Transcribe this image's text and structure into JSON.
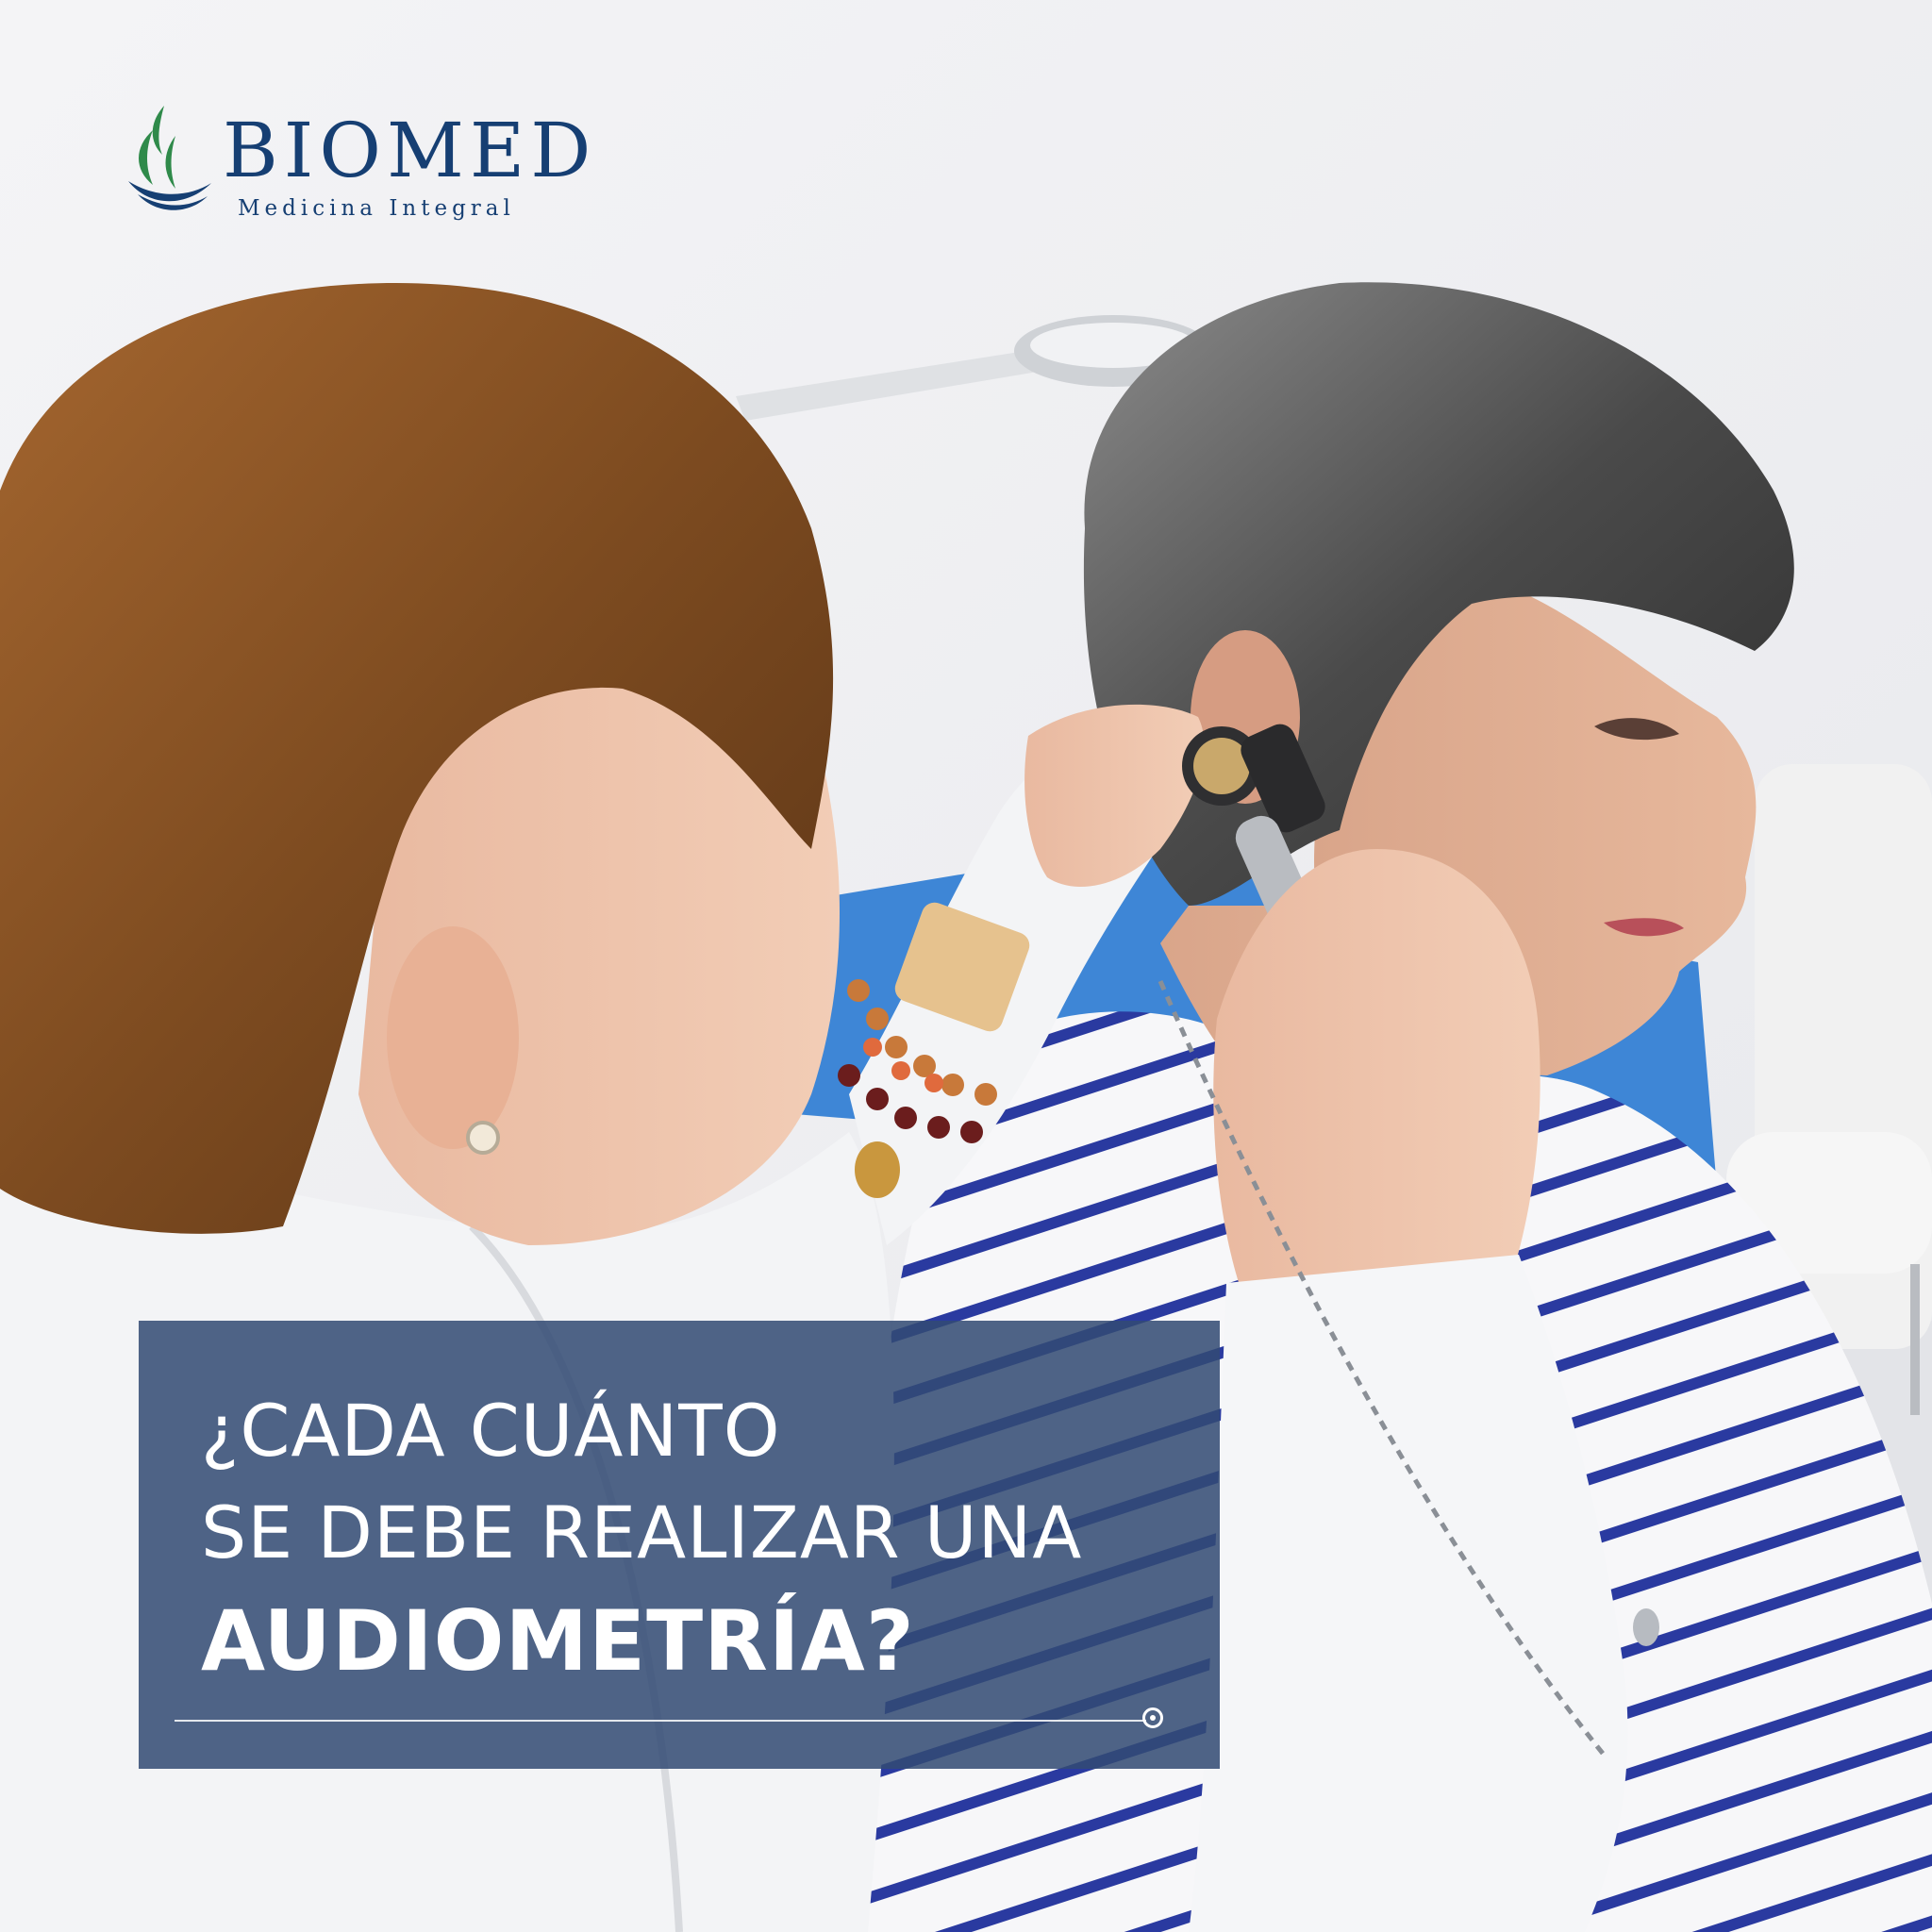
{
  "brand": {
    "name": "BIOMED",
    "tagline": "Medicina Integral",
    "primary_color": "#163f73",
    "accent_color": "#2f8a4a"
  },
  "headline": {
    "line1": "¿CADA CUÁNTO",
    "line2": "SE DEBE REALIZAR UNA",
    "line3": "AUDIOMETRÍA?"
  },
  "banner_color": "#324b73"
}
